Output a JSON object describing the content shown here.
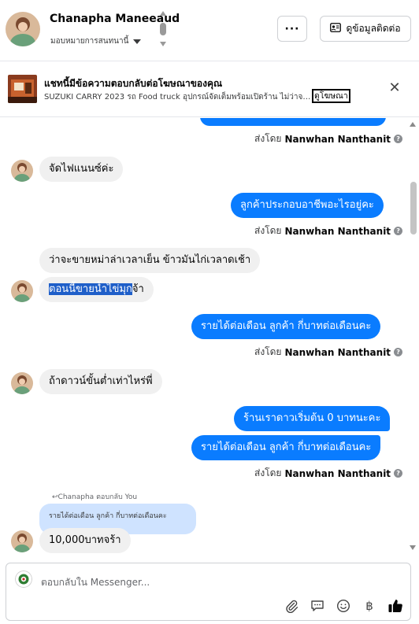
{
  "header": {
    "contact_name": "Chanapha Maneeaud",
    "assign_label": "มอบหมายการสนทนานี้",
    "more_label": "···",
    "contact_info_label": "ดูข้อมูลติดต่อ"
  },
  "ad_banner": {
    "title": "แชทนี้มีข้อความตอบกลับต่อโฆษณาของคุณ",
    "subtitle": "SUZUKI CARRY 2023 รถ Food truck อุปกรณ์จัดเต็มพร้อมเปิดร้าน ไม่ว่าจะ...",
    "view_ad_label": "ดูโฆษณา",
    "close_label": "✕"
  },
  "messages": {
    "m1_sent_by_prefix": "ส่งโดย",
    "m1_sent_by_name": "Nanwhan Nanthanit",
    "m2_text": "จัดไฟแนนซ์ค่ะ",
    "m3_text": "ลูกค้าประกอบอาชีพอะไรอยู่คะ",
    "m3_sent_by_prefix": "ส่งโดย",
    "m3_sent_by_name": "Nanwhan Nanthanit",
    "m4_text": "ว่าจะขายหม่าล่าเวลาเย็น ข้าวมันไก่เวลาดเช้า",
    "m5_text_selected": "ตอนนี้ขายน้ำไข่มุก",
    "m5_text_rest": "จ้า",
    "m6_text": "รายได้ต่อเดือน ลูกค้า กี่บาทต่อเดือนคะ",
    "m6_sent_by_prefix": "ส่งโดย",
    "m6_sent_by_name": "Nanwhan Nanthanit",
    "m7_text": "ถ้าดาวน์ขั้นต่ำเท่าไหร่พี่",
    "m8_text": "ร้านเราดาวเริ่มต้น 0 บาทนะคะ",
    "m9_text": "รายได้ต่อเดือน ลูกค้า กี่บาทต่อเดือนคะ",
    "m9_sent_by_prefix": "ส่งโดย",
    "m9_sent_by_name": "Nanwhan Nanthanit",
    "reply_meta": "Chanapha ตอบกลับ You",
    "quoted_text": "รายได้ต่อเดือน ลูกค้า กี่บาทต่อเดือนคะ",
    "m10_text": "10,000บาทจร้า"
  },
  "composer": {
    "placeholder": "ตอบกลับใน Messenger..."
  },
  "icons": {
    "attach": "paperclip-icon",
    "saved_reply": "chat-bubble-icon",
    "emoji": "smiley-icon",
    "payment": "baht-icon",
    "like": "thumbs-up-icon"
  },
  "colors": {
    "outgoing_bubble": "#0a7cff",
    "incoming_bubble": "#f0f0f0",
    "quoted_bubble": "#cfe3ff",
    "selection": "#1f5fc9"
  }
}
